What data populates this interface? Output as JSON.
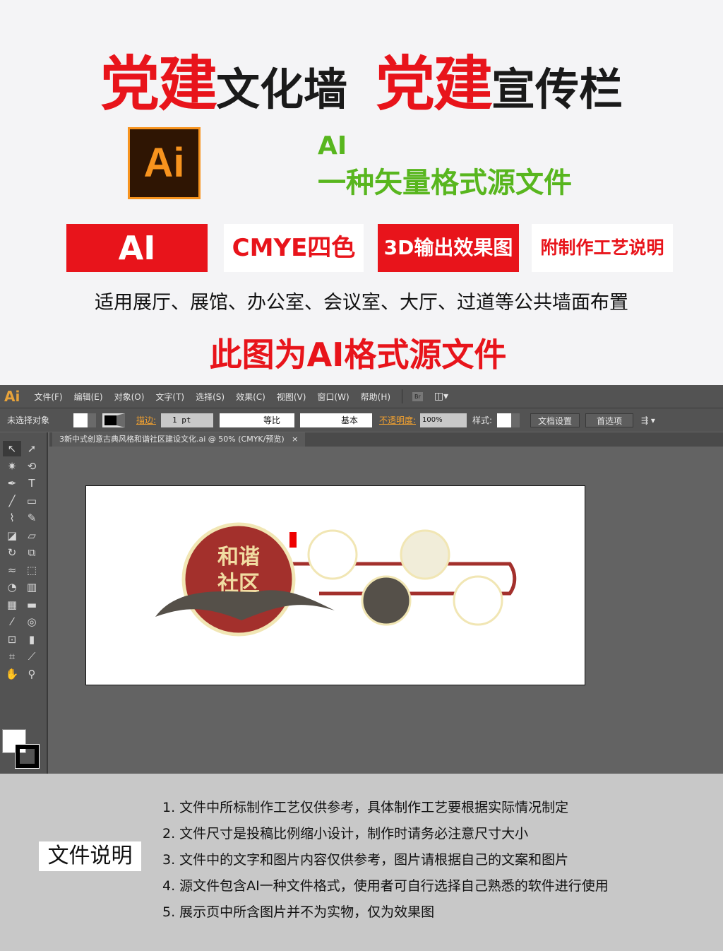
{
  "header": {
    "t1": "党建",
    "t2": "文化墙",
    "t3": "党建",
    "t4": "宣传栏"
  },
  "logo": {
    "text": "Ai",
    "border": "#f7931e",
    "bg": "#2f1503"
  },
  "format": {
    "line1": "AI",
    "line2": "一种矢量格式源文件",
    "color": "#58b61e"
  },
  "badges": [
    {
      "label": "AI"
    },
    {
      "label": "CMYE四色"
    },
    {
      "label": "3D输出效果图"
    },
    {
      "label": "附制作工艺说明"
    }
  ],
  "usage": "适用展厅、展馆、办公室、会议室、大厅、过道等公共墙面布置",
  "notice": "此图为AI格式源文件",
  "illustrator": {
    "app_icon": "Ai",
    "menu": [
      "文件(F)",
      "编辑(E)",
      "对象(O)",
      "文字(T)",
      "选择(S)",
      "效果(C)",
      "视图(V)",
      "窗口(W)",
      "帮助(H)"
    ],
    "bridge": "Br",
    "control": {
      "selection": "未选择对象",
      "stroke_label": "描边:",
      "stroke_value": "1 pt",
      "profile1": "等比",
      "profile2": "基本",
      "opacity_label": "不透明度:",
      "opacity_value": "100%",
      "style_label": "样式:",
      "doc_setup": "文档设置",
      "prefs": "首选项"
    },
    "tab": {
      "title": "3新中式创意古典风格和谐社区建设文化.ai @ 50% (CMYK/预览)",
      "close": "×"
    },
    "tools": [
      "selection",
      "direct-selection",
      "magic-wand",
      "lasso",
      "pen",
      "type",
      "line",
      "rectangle",
      "paintbrush",
      "pencil",
      "blob-brush",
      "eraser",
      "rotate",
      "scale",
      "warp",
      "free-transform",
      "shape-builder",
      "perspective-grid",
      "mesh",
      "gradient",
      "eyedropper",
      "blend",
      "symbol-sprayer",
      "column-graph",
      "artboard",
      "slice",
      "hand",
      "zoom"
    ],
    "artwork": {
      "main_title": "和谐社区",
      "colors": {
        "red": "#a3302c",
        "dark": "#555049",
        "cream": "#f1edd9"
      }
    }
  },
  "notes": {
    "label": "文件说明",
    "items": [
      "1. 文件中所标制作工艺仅供参考，具体制作工艺要根据实际情况制定",
      "2. 文件尺寸是投稿比例缩小设计，制作时请务必注意尺寸大小",
      "3. 文件中的文字和图片内容仅供参考，图片请根据自己的文案和图片",
      "4. 源文件包含AI一种文件格式，使用者可自行选择自己熟悉的软件进行使用",
      "5. 展示页中所含图片并不为实物，仅为效果图"
    ]
  }
}
